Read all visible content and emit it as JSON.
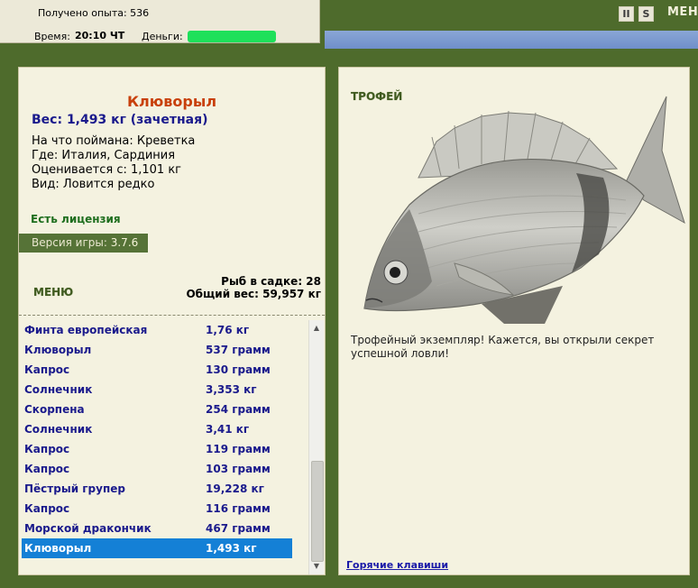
{
  "status": {
    "xp_line": "Получено опыта: 536",
    "time_label": "Время:",
    "time_value": "20:10 ЧТ",
    "money_label": "Деньги:"
  },
  "top_bar": {
    "menu_label": "МЕНЮ",
    "pause_glyph": "II",
    "save_glyph": "S"
  },
  "catch": {
    "title": "Клюворыл",
    "weight": "Вес: 1,493 кг (зачетная)",
    "bait": "На что поймана: Креветка",
    "place": "Где: Италия, Сардиния",
    "value": "Оценивается с: 1,101 кг",
    "rarity": "Вид: Ловится редко",
    "license": "Есть лицензия"
  },
  "version": {
    "label": "Версия игры:",
    "value": "3.7.6"
  },
  "menu_link": "МЕНЮ",
  "keepnet": {
    "count": "Рыб в садке: 28",
    "total": "Общий вес: 59,957 кг"
  },
  "fish_list": [
    {
      "name": "Финта европейская",
      "weight": "1,76 кг"
    },
    {
      "name": "Клюворыл",
      "weight": "537 грамм"
    },
    {
      "name": "Капрос",
      "weight": "130 грамм"
    },
    {
      "name": "Солнечник",
      "weight": "3,353 кг"
    },
    {
      "name": "Скорпена",
      "weight": "254 грамм"
    },
    {
      "name": "Солнечник",
      "weight": "3,41 кг"
    },
    {
      "name": "Капрос",
      "weight": "119 грамм"
    },
    {
      "name": "Капрос",
      "weight": "103 грамм"
    },
    {
      "name": "Пёстрый групер",
      "weight": "19,228 кг"
    },
    {
      "name": "Капрос",
      "weight": "116 грамм"
    },
    {
      "name": "Морской дракончик",
      "weight": "467 грамм"
    },
    {
      "name": "Клюворыл",
      "weight": "1,493 кг"
    }
  ],
  "selected_index": 11,
  "trophy": {
    "label": "ТРОФЕЙ",
    "text": "Трофейный экземпляр! Кажется, вы открыли секрет успешной ловли!",
    "hotkeys": "Горячие клавиши"
  },
  "colors": {
    "frame": "#4e6b2c",
    "panel": "#f4f2e0",
    "title": "#c8400b",
    "list_text": "#1a1a8c",
    "selection": "#1480d6",
    "license": "#1e6e1e"
  }
}
